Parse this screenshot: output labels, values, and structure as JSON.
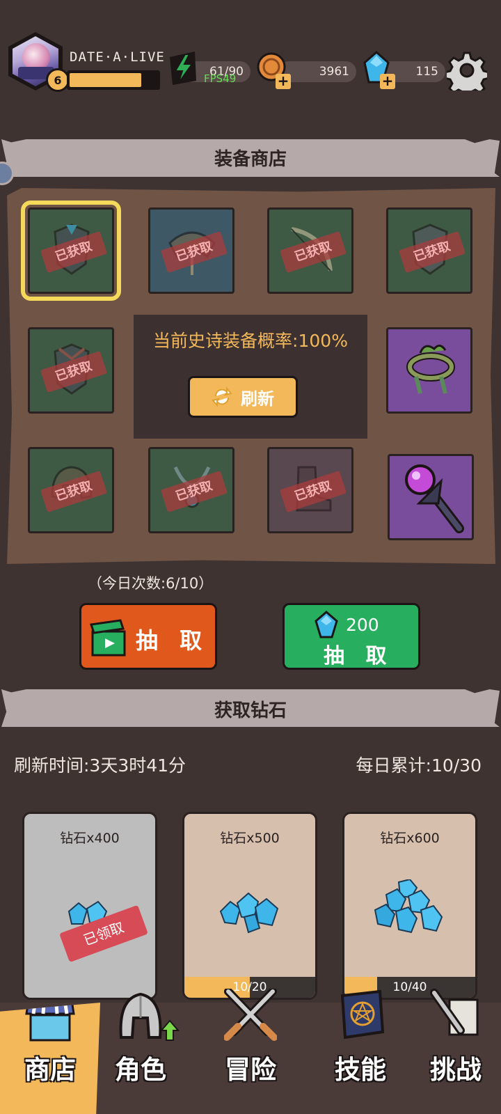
{
  "player": {
    "name": "DATE·A·LIVE",
    "level": "6",
    "xp_fraction": 0.82
  },
  "resources": {
    "energy": "61/90",
    "fps": "FPS49",
    "gold": "3961",
    "gems": "115"
  },
  "shop": {
    "title": "装备商店",
    "epic_rate": "当前史诗装备概率:100%",
    "refresh_label": "刷新",
    "cells": [
      {
        "status": "已获取",
        "icon": "armor-icon"
      },
      {
        "status": "已获取",
        "icon": "wings-icon"
      },
      {
        "status": "已获取",
        "icon": "bow-icon"
      },
      {
        "status": "已获取",
        "icon": "armor-icon"
      },
      {
        "status": "已获取",
        "icon": "armor-icon"
      },
      {
        "status": "",
        "icon": "vine-bracelet-icon"
      },
      {
        "status": "已获取",
        "icon": "helmet-icon"
      },
      {
        "status": "已获取",
        "icon": "necklace-icon"
      },
      {
        "status": "已获取",
        "icon": "boots-icon"
      },
      {
        "status": "",
        "icon": "orb-staff-icon"
      }
    ],
    "daily_count": "（今日次数:6/10）",
    "draw_ad_label": "抽 取",
    "draw_gem_cost": "200",
    "draw_gem_label": "抽 取"
  },
  "diamonds": {
    "title": "获取钻石",
    "refresh_time": "刷新时间:3天3时41分",
    "daily_total": "每日累计:10/30",
    "cards": [
      {
        "title": "钻石x400",
        "status": "已领取",
        "progress_text": "",
        "progress": 1.0
      },
      {
        "title": "钻石x500",
        "status": "",
        "progress_text": "10/20",
        "progress": 0.5
      },
      {
        "title": "钻石x600",
        "status": "",
        "progress_text": "10/40",
        "progress": 0.25
      }
    ]
  },
  "nav": {
    "items": [
      {
        "label": "商店",
        "icon": "store-icon"
      },
      {
        "label": "角色",
        "icon": "helmet-icon"
      },
      {
        "label": "冒险",
        "icon": "crossed-swords-icon"
      },
      {
        "label": "技能",
        "icon": "spellbook-icon"
      },
      {
        "label": "挑战",
        "icon": "sword-scroll-icon"
      }
    ],
    "active_index": 0
  },
  "colors": {
    "background": "#3f3332",
    "accent_gold": "#f3b85a",
    "draw_ad": "#e0581c",
    "draw_gem": "#27ae5e",
    "claimed_red": "#d64b56"
  }
}
